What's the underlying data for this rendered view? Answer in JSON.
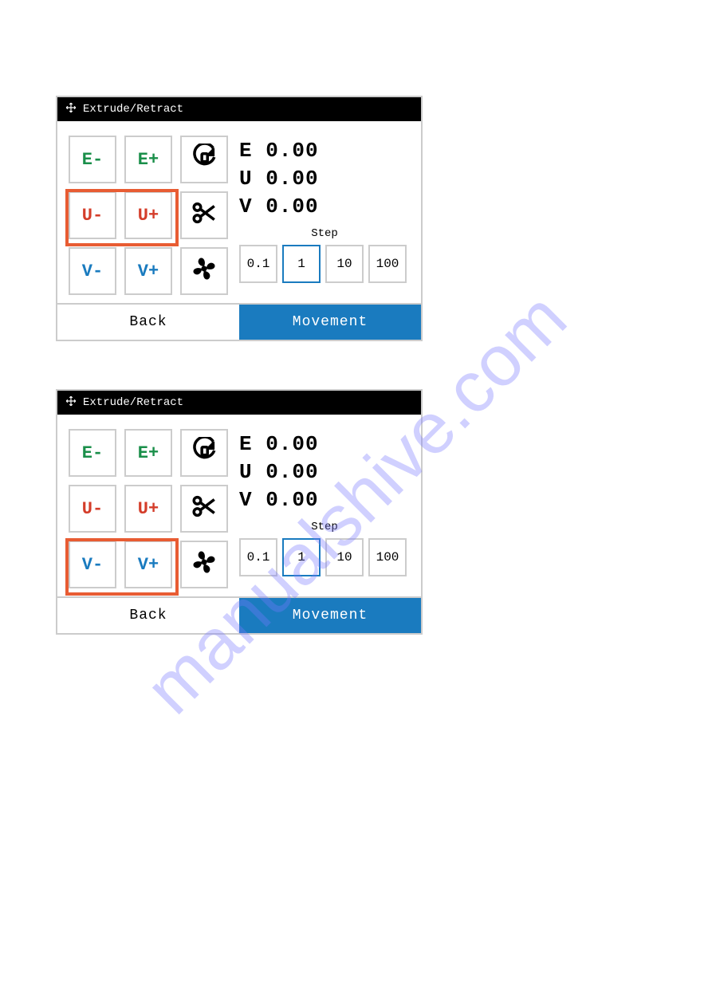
{
  "watermark": "manualshive.com",
  "panels": [
    {
      "title": "Extrude/Retract",
      "buttons": {
        "e_minus": "E-",
        "e_plus": "E+",
        "u_minus": "U-",
        "u_plus": "U+",
        "v_minus": "V-",
        "v_plus": "V+"
      },
      "icons": {
        "refresh": "refresh-icon",
        "cut": "scissors-icon",
        "fan": "fan-icon"
      },
      "readout": {
        "e": "E 0.00",
        "u": "U 0.00",
        "v": "V 0.00"
      },
      "step_label": "Step",
      "steps": [
        "0.1",
        "1",
        "10",
        "100"
      ],
      "active_step": "1",
      "highlight_row": "U",
      "footer": {
        "back": "Back",
        "movement": "Movement"
      }
    },
    {
      "title": "Extrude/Retract",
      "buttons": {
        "e_minus": "E-",
        "e_plus": "E+",
        "u_minus": "U-",
        "u_plus": "U+",
        "v_minus": "V-",
        "v_plus": "V+"
      },
      "icons": {
        "refresh": "refresh-icon",
        "cut": "scissors-icon",
        "fan": "fan-icon"
      },
      "readout": {
        "e": "E 0.00",
        "u": "U 0.00",
        "v": "V 0.00"
      },
      "step_label": "Step",
      "steps": [
        "0.1",
        "1",
        "10",
        "100"
      ],
      "active_step": "1",
      "highlight_row": "V",
      "footer": {
        "back": "Back",
        "movement": "Movement"
      }
    }
  ]
}
